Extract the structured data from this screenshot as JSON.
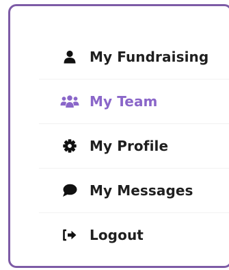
{
  "menu": {
    "items": [
      {
        "label": "My Fundraising",
        "icon": "user-icon",
        "active": false
      },
      {
        "label": "My Team",
        "icon": "users-icon",
        "active": true
      },
      {
        "label": "My Profile",
        "icon": "gear-icon",
        "active": false
      },
      {
        "label": "My Messages",
        "icon": "comment-icon",
        "active": false
      },
      {
        "label": "Logout",
        "icon": "logout-icon",
        "active": false
      }
    ]
  },
  "colors": {
    "border": "#7d5ba6",
    "active": "#8a66c9",
    "text": "#1f1f1f"
  }
}
